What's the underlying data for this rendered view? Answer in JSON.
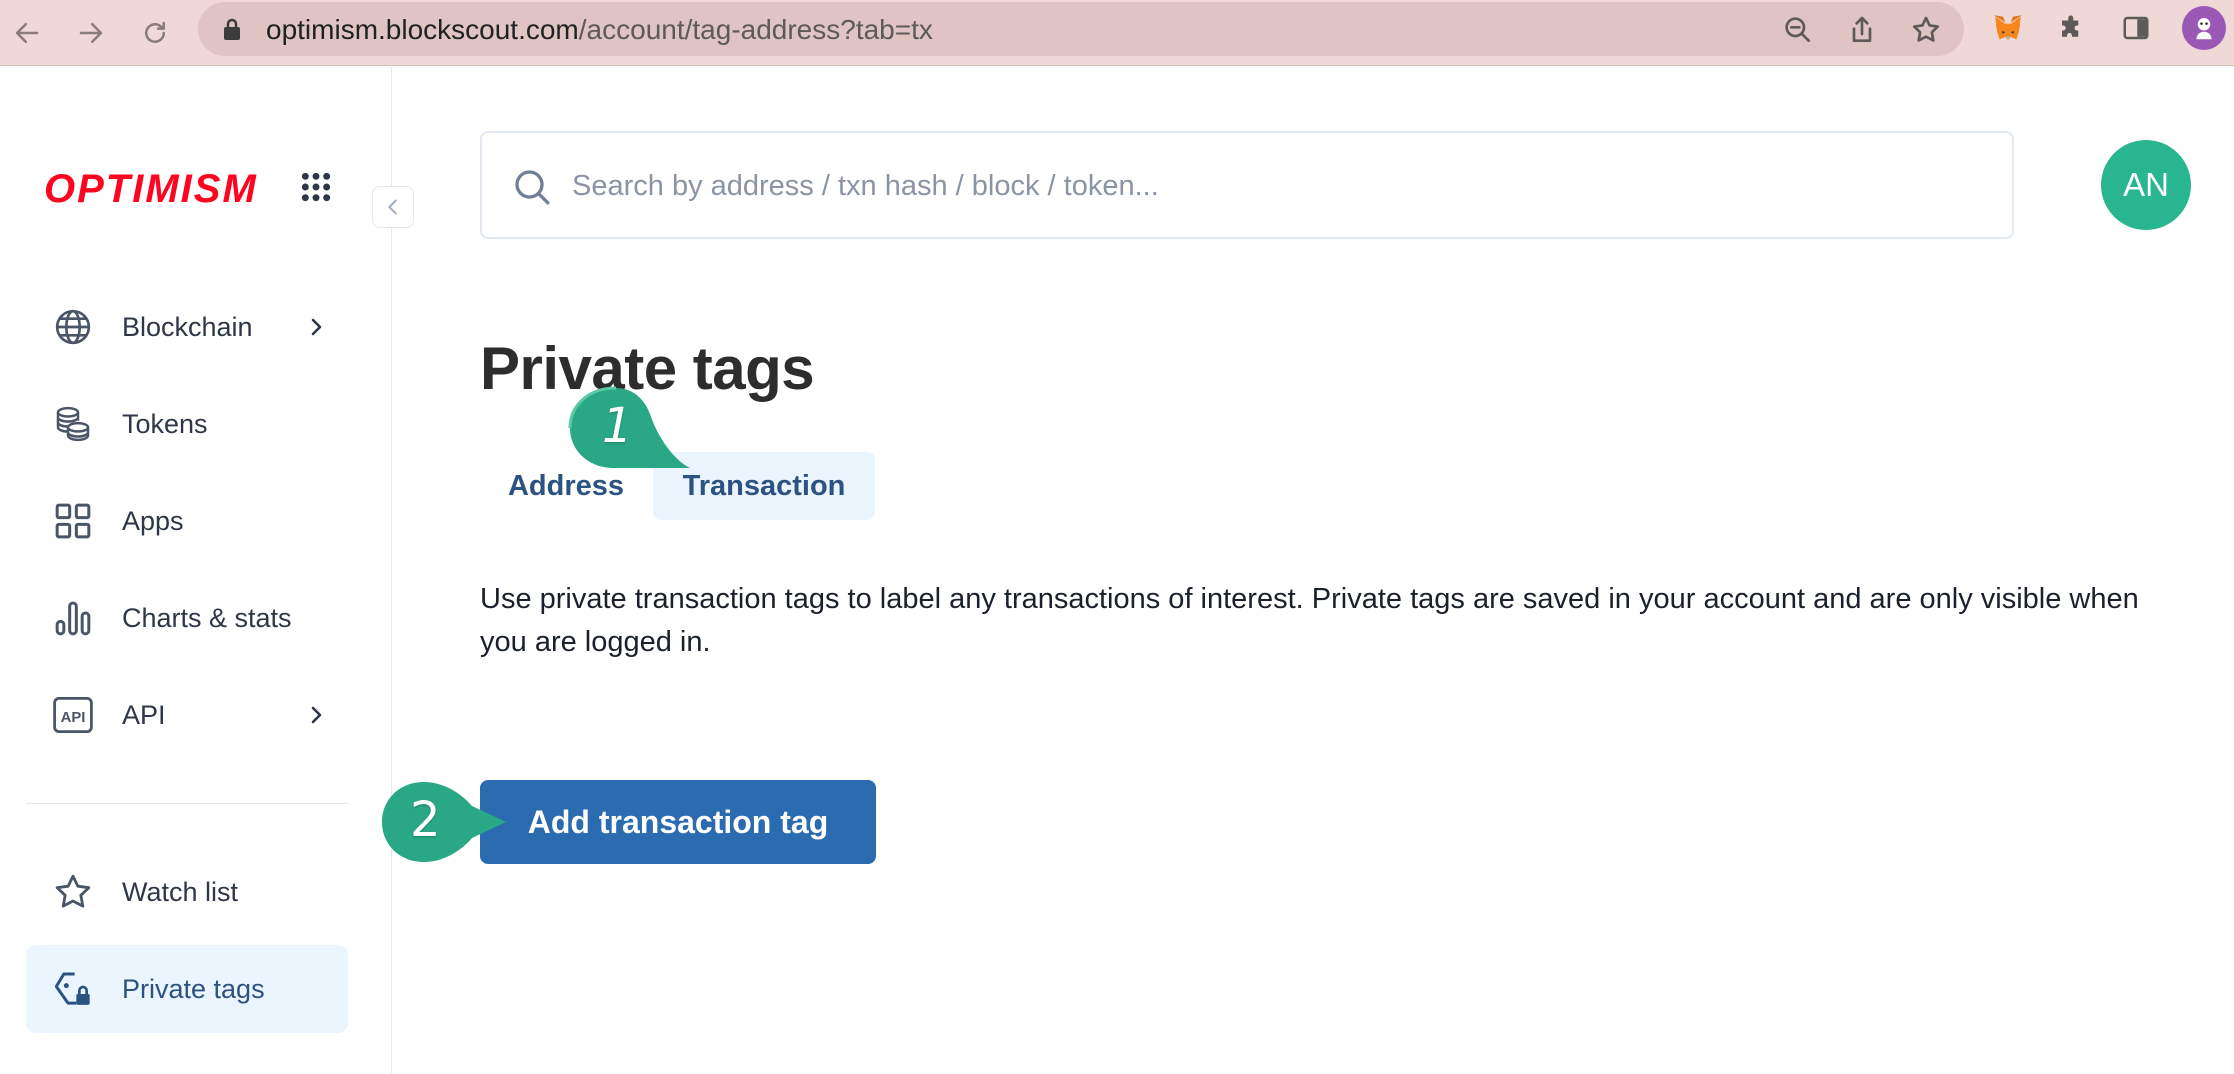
{
  "browser": {
    "url_host": "optimism.blockscout.com",
    "url_path": "/account/tag-address?tab=tx"
  },
  "colors": {
    "brand": "#ff0420",
    "accent": "#2b6cb0",
    "avatar": "#2ab591",
    "callout": "#2aa886",
    "active_bg": "#eaf5ff"
  },
  "sidebar": {
    "logo": "OPTIMISM",
    "items": [
      {
        "label": "Blockchain",
        "icon": "globe-icon",
        "has_chevron": true
      },
      {
        "label": "Tokens",
        "icon": "coins-icon",
        "has_chevron": false
      },
      {
        "label": "Apps",
        "icon": "apps-grid-icon",
        "has_chevron": false
      },
      {
        "label": "Charts & stats",
        "icon": "bar-chart-icon",
        "has_chevron": false
      },
      {
        "label": "API",
        "icon": "api-icon",
        "has_chevron": true
      }
    ],
    "account_items": [
      {
        "label": "Watch list",
        "icon": "star-icon",
        "active": false
      },
      {
        "label": "Private tags",
        "icon": "tag-lock-icon",
        "active": true
      }
    ]
  },
  "header": {
    "search_placeholder": "Search by address / txn hash / block / token...",
    "avatar_initials": "AN"
  },
  "main": {
    "title": "Private tags",
    "tabs": [
      {
        "label": "Address",
        "active": false
      },
      {
        "label": "Transaction",
        "active": true
      }
    ],
    "description": "Use private transaction tags to label any transactions of interest. Private tags are saved in your account and are only visible when you are logged in.",
    "primary_button": "Add transaction tag"
  },
  "callouts": [
    {
      "number": "1",
      "target": "tab-transaction"
    },
    {
      "number": "2",
      "target": "add-transaction-tag-button"
    }
  ]
}
